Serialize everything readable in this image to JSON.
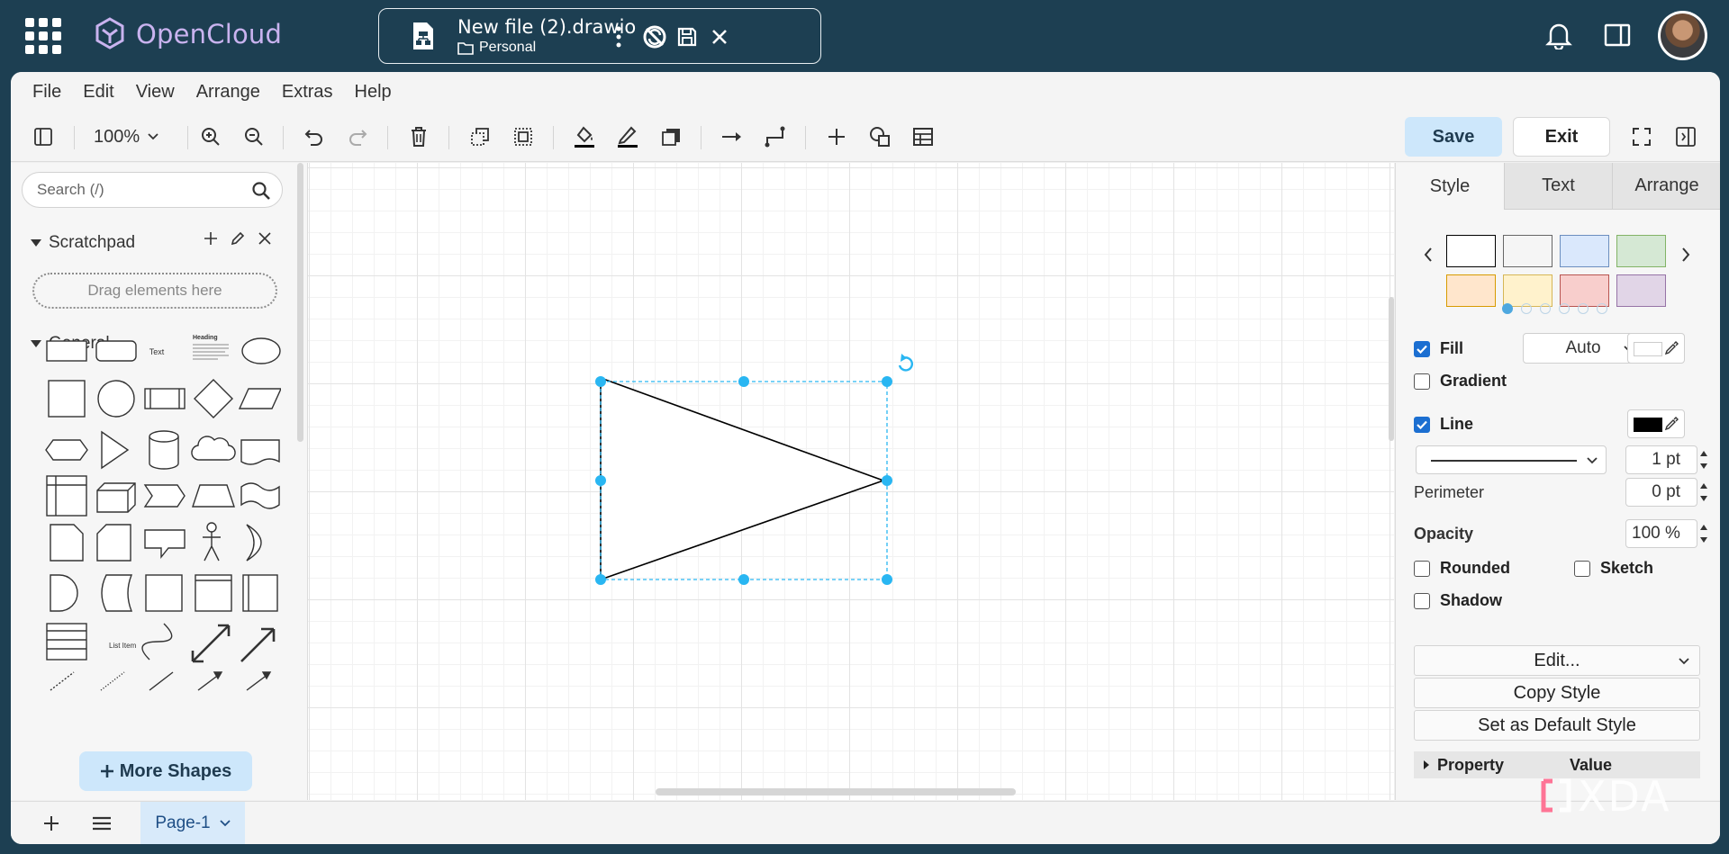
{
  "header": {
    "brand": "OpenCloud",
    "file_title": "New file (2).drawio",
    "file_location": "Personal"
  },
  "menu": [
    "File",
    "Edit",
    "View",
    "Arrange",
    "Extras",
    "Help"
  ],
  "toolbar": {
    "zoom": "100%",
    "save_label": "Save",
    "exit_label": "Exit"
  },
  "left": {
    "search_placeholder": "Search (/)",
    "scratchpad_title": "Scratchpad",
    "dropzone_text": "Drag elements here",
    "general_title": "General",
    "shape_text_label": "Text",
    "shape_heading_label": "Heading",
    "shape_list_label": "List Item",
    "more_shapes": "More Shapes"
  },
  "right": {
    "tabs": [
      "Style",
      "Text",
      "Arrange"
    ],
    "swatch_colors": [
      {
        "fill": "#ffffff",
        "stroke": "#000000"
      },
      {
        "fill": "#f5f5f5",
        "stroke": "#666666"
      },
      {
        "fill": "#dae8fc",
        "stroke": "#6c8ebf"
      },
      {
        "fill": "#d5e8d4",
        "stroke": "#82b366"
      },
      {
        "fill": "#ffe6cc",
        "stroke": "#d79b00"
      },
      {
        "fill": "#fff2cc",
        "stroke": "#d6b656"
      },
      {
        "fill": "#f8cecc",
        "stroke": "#b85450"
      },
      {
        "fill": "#e1d5e7",
        "stroke": "#9673a6"
      }
    ],
    "fill_label": "Fill",
    "fill_mode": "Auto",
    "gradient_label": "Gradient",
    "line_label": "Line",
    "line_width": "1 pt",
    "perimeter_label": "Perimeter",
    "perimeter_value": "0 pt",
    "opacity_label": "Opacity",
    "opacity_value": "100 %",
    "rounded_label": "Rounded",
    "sketch_label": "Sketch",
    "shadow_label": "Shadow",
    "edit_label": "Edit...",
    "copy_style": "Copy Style",
    "set_default_style": "Set as Default Style",
    "prop_col": "Property",
    "value_col": "Value"
  },
  "bottom": {
    "page_tab": "Page-1"
  },
  "watermark": "XDA",
  "colors": {
    "accent": "#29b6f2",
    "topbar": "#1d3f52",
    "primary_button": "#cde7fb",
    "checkbox": "#1c6fd1"
  }
}
